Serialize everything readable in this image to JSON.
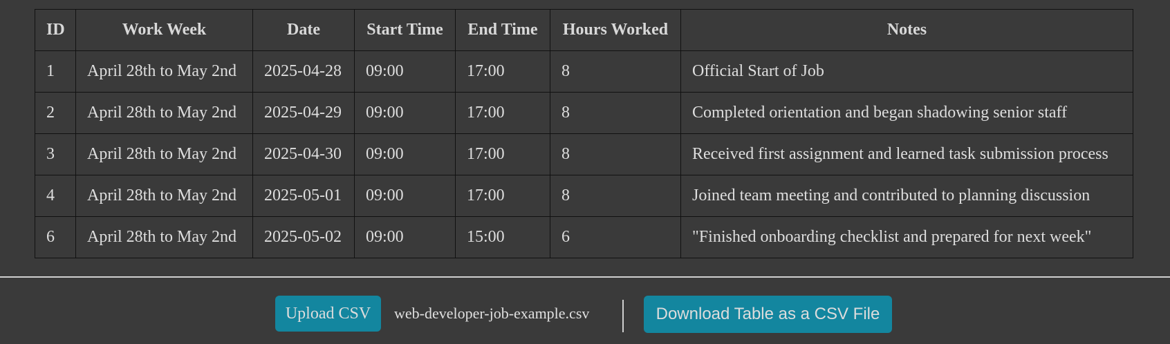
{
  "table": {
    "headers": [
      "ID",
      "Work Week",
      "Date",
      "Start Time",
      "End Time",
      "Hours Worked",
      "Notes"
    ],
    "rows": [
      [
        "1",
        "April 28th to May 2nd",
        "2025-04-28",
        "09:00",
        "17:00",
        "8",
        "Official Start of Job"
      ],
      [
        "2",
        "April 28th to May 2nd",
        "2025-04-29",
        "09:00",
        "17:00",
        "8",
        "Completed orientation and began shadowing senior staff"
      ],
      [
        "3",
        "April 28th to May 2nd",
        "2025-04-30",
        "09:00",
        "17:00",
        "8",
        "Received first assignment and learned task submission process"
      ],
      [
        "4",
        "April 28th to May 2nd",
        "2025-05-01",
        "09:00",
        "17:00",
        "8",
        "Joined team meeting and contributed to planning discussion"
      ],
      [
        "6",
        "April 28th to May 2nd",
        "2025-05-02",
        "09:00",
        "15:00",
        "6",
        "\"Finished onboarding checklist and prepared for next week\""
      ]
    ]
  },
  "controls": {
    "upload_label": "Upload CSV",
    "file_name": "web-developer-job-example.csv",
    "download_label": "Download Table as a CSV File"
  },
  "colors": {
    "background": "#3a3a3a",
    "button": "#13869f",
    "text": "#dcdcdc"
  }
}
